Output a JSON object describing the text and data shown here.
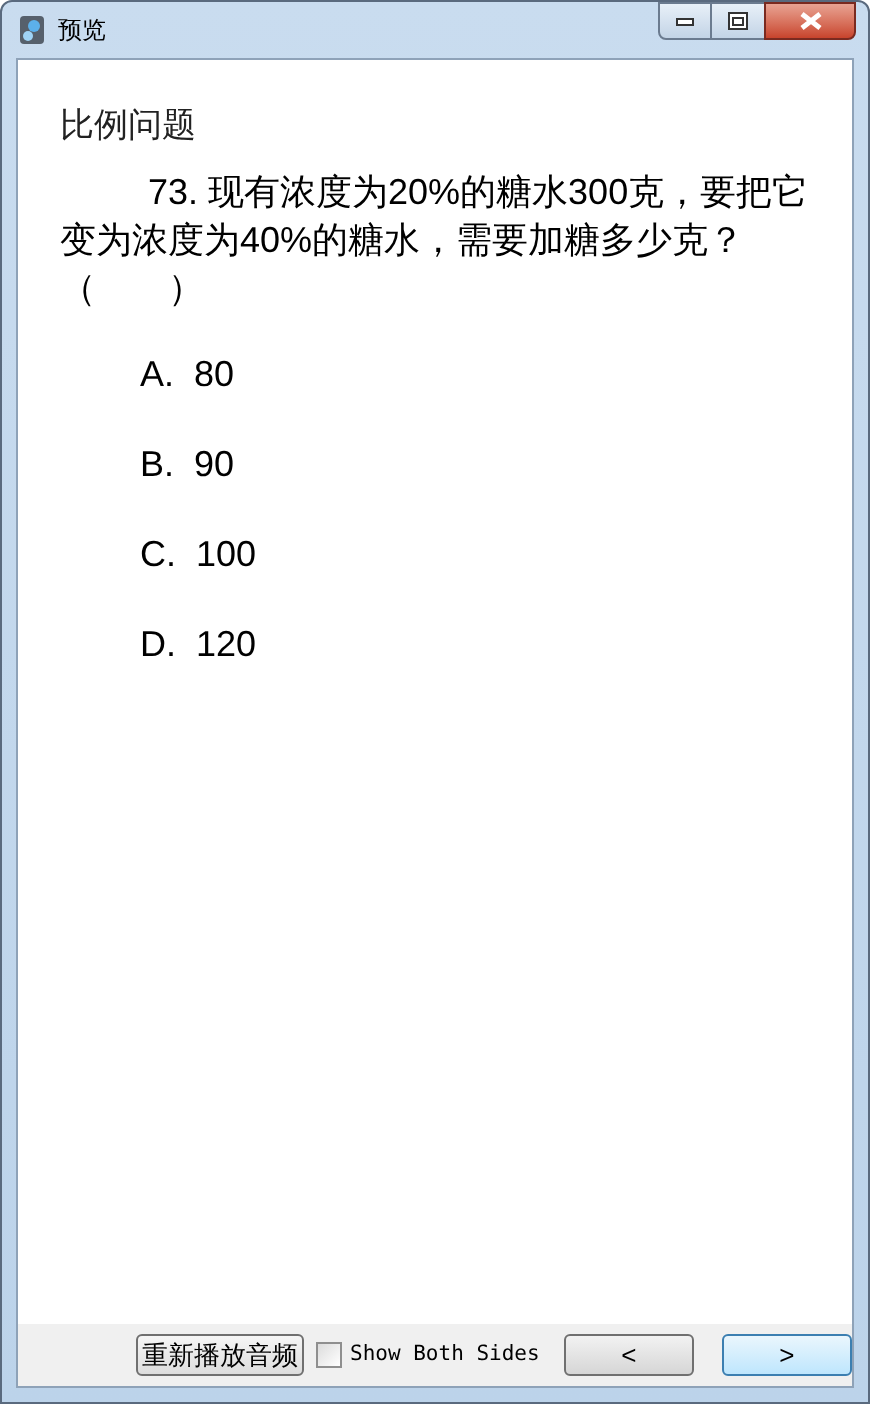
{
  "window": {
    "title": "预览"
  },
  "section_title": "比例问题",
  "question": "73. 现有浓度为20%的糖水300克，要把它变为浓度为40%的糖水，需要加糖多少克？（　　）",
  "options": [
    "A.  80",
    "B.  90",
    "C.  100",
    "D.  120"
  ],
  "footer": {
    "replay_button": "重新播放音频",
    "show_both_sides": {
      "label": "Show Both Sides",
      "checked": false
    },
    "prev_button": "<",
    "next_button": ">"
  }
}
